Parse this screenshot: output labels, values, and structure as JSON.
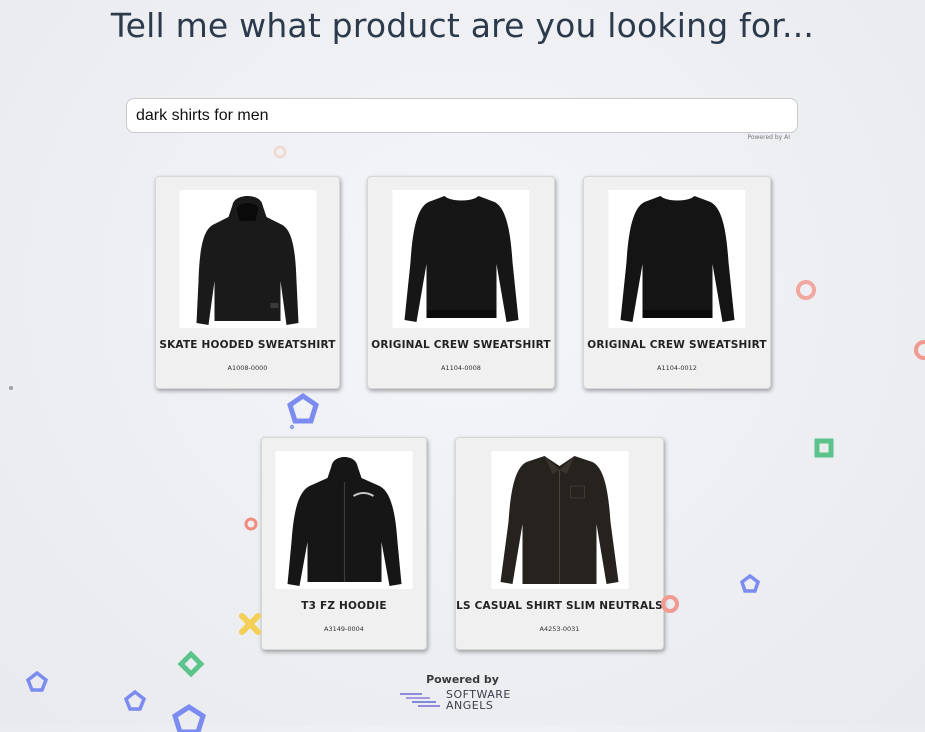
{
  "page": {
    "title": "Tell me what product are you looking for...",
    "powered_by_ai": "Powered by AI"
  },
  "search": {
    "value": "dark shirts for men"
  },
  "products": [
    {
      "name": "SKATE HOODED SWEATSHIRT",
      "code": "A1008-0000",
      "image": "hoodie-pullover-icon"
    },
    {
      "name": "ORIGINAL CREW SWEATSHIRT",
      "code": "A1104-0008",
      "image": "crew-sweatshirt-icon"
    },
    {
      "name": "ORIGINAL CREW SWEATSHIRT",
      "code": "A1104-0012",
      "image": "crew-sweatshirt-icon"
    },
    {
      "name": "T3 FZ HOODIE",
      "code": "A3149-0004",
      "image": "zip-hoodie-icon"
    },
    {
      "name": "LS CASUAL SHIRT SLIM NEUTRALS",
      "code": "A4253-0031",
      "image": "button-shirt-icon"
    }
  ],
  "footer": {
    "powered_by": "Powered by",
    "brand_line1": "SOFTWARE",
    "brand_line2": "ANGELS"
  },
  "colors": {
    "title": "#2c3a4b",
    "card_bg": "#f0f0f0",
    "garment": "#151515",
    "deco_blue": "#6f7fe8",
    "deco_green": "#5cc48a",
    "deco_red": "#f08a7e",
    "deco_yellow": "#f5c94a"
  }
}
